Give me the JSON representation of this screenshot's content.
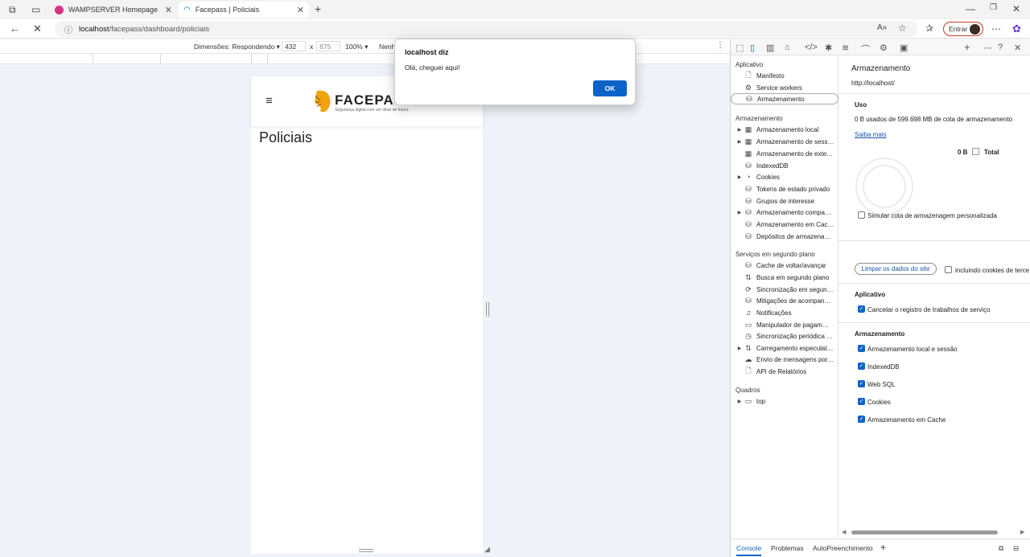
{
  "tabs": [
    {
      "label": "WAMPSERVER Homepage",
      "active": false
    },
    {
      "label": "Facepass | Policiais",
      "active": true
    }
  ],
  "address": {
    "host": "localhost",
    "path": "/facepass/dashboard/policiais"
  },
  "signin": "Entrar",
  "devbar": {
    "dimensions": "Dimensões: Respondendo",
    "width": "432",
    "times": "x",
    "height": "875",
    "zoom": "100%",
    "throttle": "Nenh"
  },
  "page": {
    "brand": "FACEPASS",
    "tagline": "Segurança digital com um olhar de futuro",
    "title": "Policiais"
  },
  "dialog": {
    "title": "localhost diz",
    "message": "Olá, cheguei aqui!",
    "ok": "OK"
  },
  "devtools": {
    "nav": {
      "app_section": "Aplicativo",
      "app_items": [
        "Manifesto",
        "Service workers",
        "Armazenamento"
      ],
      "storage_section": "Armazenamento",
      "storage_items": [
        "Armazenamento local",
        "Armazenamento de sess…",
        "Armazenamento de exte…",
        "IndexedDB",
        "Cookies",
        "Tokens de estado privado",
        "Grupos de interesse",
        "Armazenamento compa…",
        "Armazenamento em Cac…",
        "Depósitos de armazena…"
      ],
      "bg_section": "Serviços em segundo plano",
      "bg_items": [
        "Cache de voltar/avançar",
        "Busca em segundo plano",
        "Sincronização em segun…",
        "Mitigações de acompan…",
        "Notificações",
        "Manipulador de pagam…",
        "Sincronização periódica …",
        "Carregamento especulat…",
        "Envio de mensagens por…",
        "API de Relatórios"
      ],
      "frames_section": "Quadros",
      "frames_items": [
        "top"
      ]
    },
    "main": {
      "title": "Armazenamento",
      "origin": "http://localhost/",
      "usage_heading": "Uso",
      "usage_text": "0 B usados de 599.698 MB de cota de armazenamento",
      "learn_more": "Saiba mais",
      "total_value": "0 B",
      "total_label": "Total",
      "simulate": "Simular cota de armazenagem personalizada",
      "clear_button": "Limpar os dados do site",
      "include_third": "incluindo cookies de terce",
      "app_heading": "Aplicativo",
      "app_check": "Cancelar o registro de trabalhos de serviço",
      "storage_heading": "Armazenamento",
      "storage_checks": [
        "Armazenamento local e sessão",
        "IndexedDB",
        "Web SQL",
        "Cookies",
        "Armazenamento em Cache"
      ]
    },
    "bottom_tabs": [
      "Console",
      "Problemas",
      "AutoPreenchimento"
    ]
  }
}
